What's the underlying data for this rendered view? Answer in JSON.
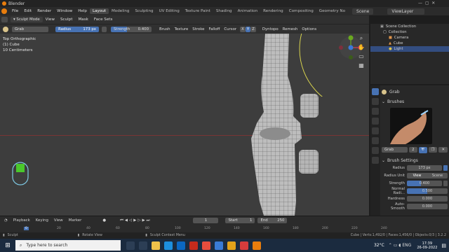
{
  "window": {
    "title": "Blender"
  },
  "menu": {
    "items": [
      "File",
      "Edit",
      "Render",
      "Window",
      "Help"
    ],
    "workspaces": [
      "Layout",
      "Modeling",
      "Sculpting",
      "UV Editing",
      "Texture Paint",
      "Shading",
      "Animation",
      "Rendering",
      "Compositing",
      "Geometry No"
    ],
    "active_workspace": "Layout",
    "scene": "Scene",
    "view_layer": "ViewLayer"
  },
  "header": {
    "mode": "Sculpt Mode",
    "items": [
      "View",
      "Sculpt",
      "Mask",
      "Face Sets"
    ]
  },
  "tool_settings": {
    "brush_name": "Grab",
    "radius_label": "Radius",
    "radius_value": "173 px",
    "strength_label": "Strength",
    "strength_value": "0.400",
    "menus": [
      "Brush",
      "Texture",
      "Stroke",
      "Falloff",
      "Cursor"
    ],
    "axis": [
      "X",
      "Y",
      "Z"
    ],
    "dyntopo": "Dyntopo",
    "remesh": "Remesh",
    "options": "Options"
  },
  "viewport": {
    "view": "Top Orthographic",
    "object": "(1) Cube",
    "scale": "10 Centimeters"
  },
  "outliner": {
    "title": "Scene Collection",
    "items": [
      {
        "label": "Collection",
        "icon": "collection-icon"
      },
      {
        "label": "Camera",
        "icon": "camera-icon"
      },
      {
        "label": "Cube",
        "icon": "mesh-icon"
      },
      {
        "label": "Light",
        "icon": "light-icon"
      }
    ]
  },
  "properties": {
    "brush_title": "Grab",
    "brushes_panel": "Brushes",
    "brush_field": "Grab",
    "brush_users": "2",
    "brush_settings_panel": "Brush Settings",
    "radius_label": "Radius",
    "radius_value": "173 px",
    "radius_unit_label": "Radius Unit",
    "radius_unit_view": "View",
    "radius_unit_scene": "Scene",
    "strength_label": "Strength",
    "strength_value": "0.400",
    "normal_radius_label": "Normal Radi...",
    "normal_radius_value": "0.500",
    "hardness_label": "Hardness",
    "hardness_value": "0.000",
    "autosmooth_label": "Auto-Smooth",
    "autosmooth_value": "0.000"
  },
  "timeline": {
    "menus": [
      "Playback",
      "Keying",
      "View",
      "Marker"
    ],
    "current_frame": "1",
    "start_label": "Start",
    "start_value": "1",
    "end_label": "End",
    "end_value": "250",
    "ticks": [
      "0",
      "20",
      "40",
      "60",
      "80",
      "100",
      "120",
      "140",
      "160",
      "180",
      "200",
      "220",
      "240"
    ]
  },
  "status": {
    "left": "Sculpt",
    "middle1": "Rotate View",
    "middle2": "Sculpt Context Menu",
    "right": "Cube | Verts:1,492/0 | Faces:1,456/0 | Objects:0/3 | 3.2.2"
  },
  "taskbar": {
    "search_placeholder": "Type here to search",
    "temperature": "32°C",
    "time": "17:39",
    "date": "26-09-2022",
    "colors": {
      "start": "#ffffff",
      "background": "#1b2b3f"
    }
  }
}
